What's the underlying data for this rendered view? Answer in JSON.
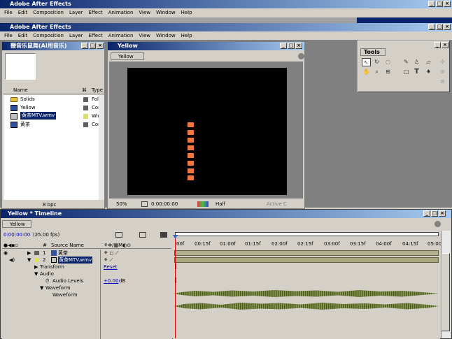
{
  "outer_window": {
    "title": "Adobe After Effects"
  },
  "menu": [
    "File",
    "Edit",
    "Composition",
    "Layer",
    "Effect",
    "Animation",
    "View",
    "Window",
    "Help"
  ],
  "bg_tabs": {
    "left": "...",
    "right": "Yellow"
  },
  "inner_window": {
    "title": "Adobe After Effects"
  },
  "project": {
    "title": "鞭音乐鼠舞(AI用音乐)",
    "col_name": "Name",
    "col_type": "Type",
    "items": [
      {
        "name": "Solids",
        "type": "Fol",
        "icon": "folder-icon"
      },
      {
        "name": "Yellow",
        "type": "Com",
        "icon": "composition-icon"
      },
      {
        "name": "黄茶MTV.wmv",
        "type": "Win",
        "icon": "video-file-icon",
        "selected": true
      },
      {
        "name": "黄茶",
        "type": "Com",
        "icon": "composition-icon"
      }
    ],
    "bpc": "8 bpc"
  },
  "comp_viewer": {
    "title": "Yellow",
    "tab": "Yellow",
    "zoom": "50%",
    "timecode": "0:00:00:00",
    "resolution": "Half",
    "camera": "Active C"
  },
  "tools": {
    "title": "Tools"
  },
  "timeline": {
    "title": "Yellow * Timeline",
    "tab": "Yellow",
    "timecode": "0:00:00:00",
    "fps": "(25.00 fps)",
    "col_hash": "#",
    "col_source": "Source Name",
    "ruler": [
      "00f",
      "00:15f",
      "01:00f",
      "01:15f",
      "02:00f",
      "02:15f",
      "03:00f",
      "03:15f",
      "04:00f",
      "04:15f",
      "05:00"
    ],
    "layers": [
      {
        "num": "1",
        "name": "黄茶"
      },
      {
        "num": "2",
        "name": "黄茶MTV.wmv"
      }
    ],
    "props": {
      "transform": "Transform",
      "reset": "Reset",
      "audio": "Audio",
      "audio_levels": "Audio Levels",
      "audio_levels_val": "+0.00",
      "db": "dB",
      "waveform": "Waveform",
      "waveform2": "Waveform"
    }
  },
  "colors": {
    "accent": "#0a246a",
    "square": "#f07840",
    "playhead": "#e00000",
    "wave": "#6b7a3a"
  }
}
